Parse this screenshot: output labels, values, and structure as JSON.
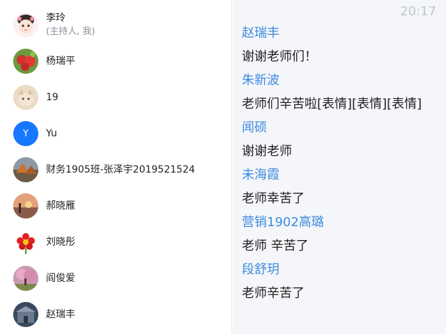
{
  "participants": [
    {
      "name": "李玲",
      "sub": "(主持人, 我)",
      "avatar": "cartoon-girl-avatar"
    },
    {
      "name": "杨瑞平",
      "avatar": "strawberries-avatar"
    },
    {
      "name": "19",
      "avatar": "kitten-avatar"
    },
    {
      "name": "Yu",
      "avatar": "letter-avatar",
      "initial": "Y",
      "color": "#1677ff"
    },
    {
      "name": "财务1905班-张泽宇2019521524",
      "avatar": "landscape-avatar"
    },
    {
      "name": "郝晓雁",
      "avatar": "sunset-avatar"
    },
    {
      "name": "刘晓彤",
      "avatar": "red-flower-avatar"
    },
    {
      "name": "阎俊爱",
      "avatar": "blossom-tree-avatar"
    },
    {
      "name": "赵瑞丰",
      "avatar": "building-avatar"
    }
  ],
  "chat": {
    "time": "20:17",
    "messages": [
      {
        "sender": "赵瑞丰",
        "text": "谢谢老师们！"
      },
      {
        "sender": "朱新波",
        "text": "老师们辛苦啦[表情][表情][表情]"
      },
      {
        "sender": "闻硕",
        "text": "谢谢老师"
      },
      {
        "sender": "未海霞",
        "text": "老师幸苦了"
      },
      {
        "sender": "营销1902高璐",
        "text": "老师 辛苦了"
      },
      {
        "sender": "段舒玥",
        "text": "老师辛苦了"
      }
    ]
  },
  "colors": {
    "sender": "#3d8be0",
    "text": "#1f1f1f",
    "chat_bg": "#f4f6f9",
    "clock": "#c3c7cd"
  }
}
